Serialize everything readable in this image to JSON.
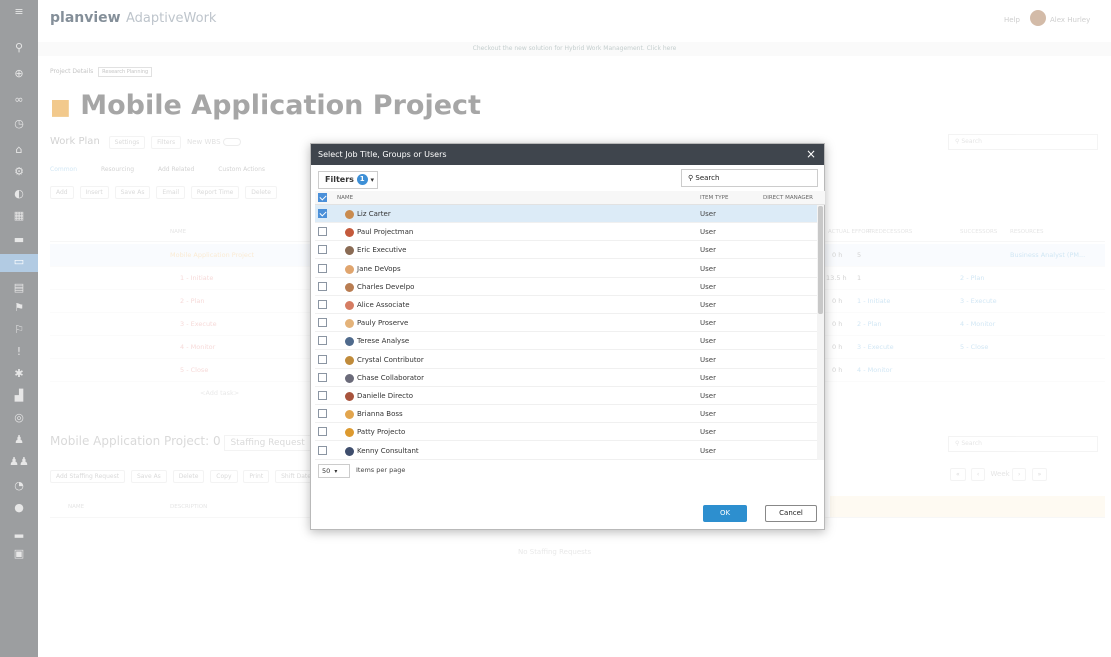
{
  "app": {
    "brand": "planview",
    "product": "AdaptiveWork",
    "help": "Help",
    "user": "Alex Hurley"
  },
  "banner": "Checkout the new solution for Hybrid Work Management. Click here",
  "breadcrumb": {
    "label": "Project Details",
    "tag": "Research Planning"
  },
  "project": {
    "title": "Mobile Application Project"
  },
  "workplan": {
    "label": "Work Plan",
    "settings": "Settings",
    "filters": "Filters",
    "new_wbs": "New WBS",
    "search_placeholder": "Search",
    "tabs": [
      "Common",
      "Resourcing",
      "Add Related",
      "Custom Actions"
    ],
    "toolbar": [
      "Add",
      "Insert",
      "Save As",
      "Email",
      "Report Time",
      "Delete"
    ],
    "columns": [
      "NAME",
      "ACTUAL EFFORT",
      "PREDECESSORS",
      "SUCCESSORS",
      "RESOURCES"
    ],
    "rows": [
      {
        "name": "Mobile Application Project",
        "hours": "0 h",
        "pred": "5",
        "succ": "",
        "res": "Business Analyst (PM..."
      },
      {
        "name": "1 - Initiate",
        "hours": "13.5 h",
        "pred": "1",
        "succ": "2 - Plan",
        "res": ""
      },
      {
        "name": "2 - Plan",
        "hours": "0 h",
        "pred": "1 - Initiate",
        "succ": "3 - Execute",
        "res": ""
      },
      {
        "name": "3 - Execute",
        "hours": "0 h",
        "pred": "2 - Plan",
        "succ": "4 - Monitor",
        "res": ""
      },
      {
        "name": "4 - Monitor",
        "hours": "0 h",
        "pred": "3 - Execute",
        "succ": "5 - Close",
        "res": ""
      },
      {
        "name": "5 - Close",
        "hours": "0 h",
        "pred": "4 - Monitor",
        "succ": "",
        "res": ""
      }
    ],
    "add_task": "<Add task>"
  },
  "staffing": {
    "title": "Mobile Application Project:",
    "count": "0",
    "dropdown": "Staffing Request",
    "search_placeholder": "Search",
    "add_button": "Add Staffing Request",
    "toolbar": [
      "Save As",
      "Delete",
      "Copy",
      "Print",
      "Shift Dates"
    ],
    "columns": [
      "NAME",
      "DESCRIPTION"
    ],
    "week_label": "Week",
    "empty": "No Staffing Requests"
  },
  "modal": {
    "title": "Select Job Title, Groups or Users",
    "close": "×",
    "filters_label": "Filters",
    "filters_count": "1",
    "search_placeholder": "Search",
    "columns": {
      "name": "NAME",
      "item_type": "ITEM TYPE",
      "direct_manager": "DIRECT MANAGER"
    },
    "rows": [
      {
        "name": "Liz Carter",
        "type": "User",
        "checked": true,
        "color": "#c98b4f"
      },
      {
        "name": "Paul Projectman",
        "type": "User",
        "checked": false,
        "color": "#c45a3c"
      },
      {
        "name": "Eric Executive",
        "type": "User",
        "checked": false,
        "color": "#8a6b54"
      },
      {
        "name": "Jane DeVops",
        "type": "User",
        "checked": false,
        "color": "#e0a56e"
      },
      {
        "name": "Charles Develpo",
        "type": "User",
        "checked": false,
        "color": "#b97d52"
      },
      {
        "name": "Alice Associate",
        "type": "User",
        "checked": false,
        "color": "#d67d63"
      },
      {
        "name": "Pauly Proserve",
        "type": "User",
        "checked": false,
        "color": "#e4b37a"
      },
      {
        "name": "Terese Analyse",
        "type": "User",
        "checked": false,
        "color": "#4f6a8c"
      },
      {
        "name": "Crystal Contributor",
        "type": "User",
        "checked": false,
        "color": "#c08b3b"
      },
      {
        "name": "Chase Collaborator",
        "type": "User",
        "checked": false,
        "color": "#6b6b7a"
      },
      {
        "name": "Danielle Directo",
        "type": "User",
        "checked": false,
        "color": "#a8543d"
      },
      {
        "name": "Brianna Boss",
        "type": "User",
        "checked": false,
        "color": "#e2a54e"
      },
      {
        "name": "Patty Projecto",
        "type": "User",
        "checked": false,
        "color": "#dd9a2f"
      },
      {
        "name": "Kenny Consultant",
        "type": "User",
        "checked": false,
        "color": "#3f4e6d"
      }
    ],
    "per_page_value": "50",
    "per_page_label": "Items per page",
    "ok": "OK",
    "cancel": "Cancel"
  }
}
